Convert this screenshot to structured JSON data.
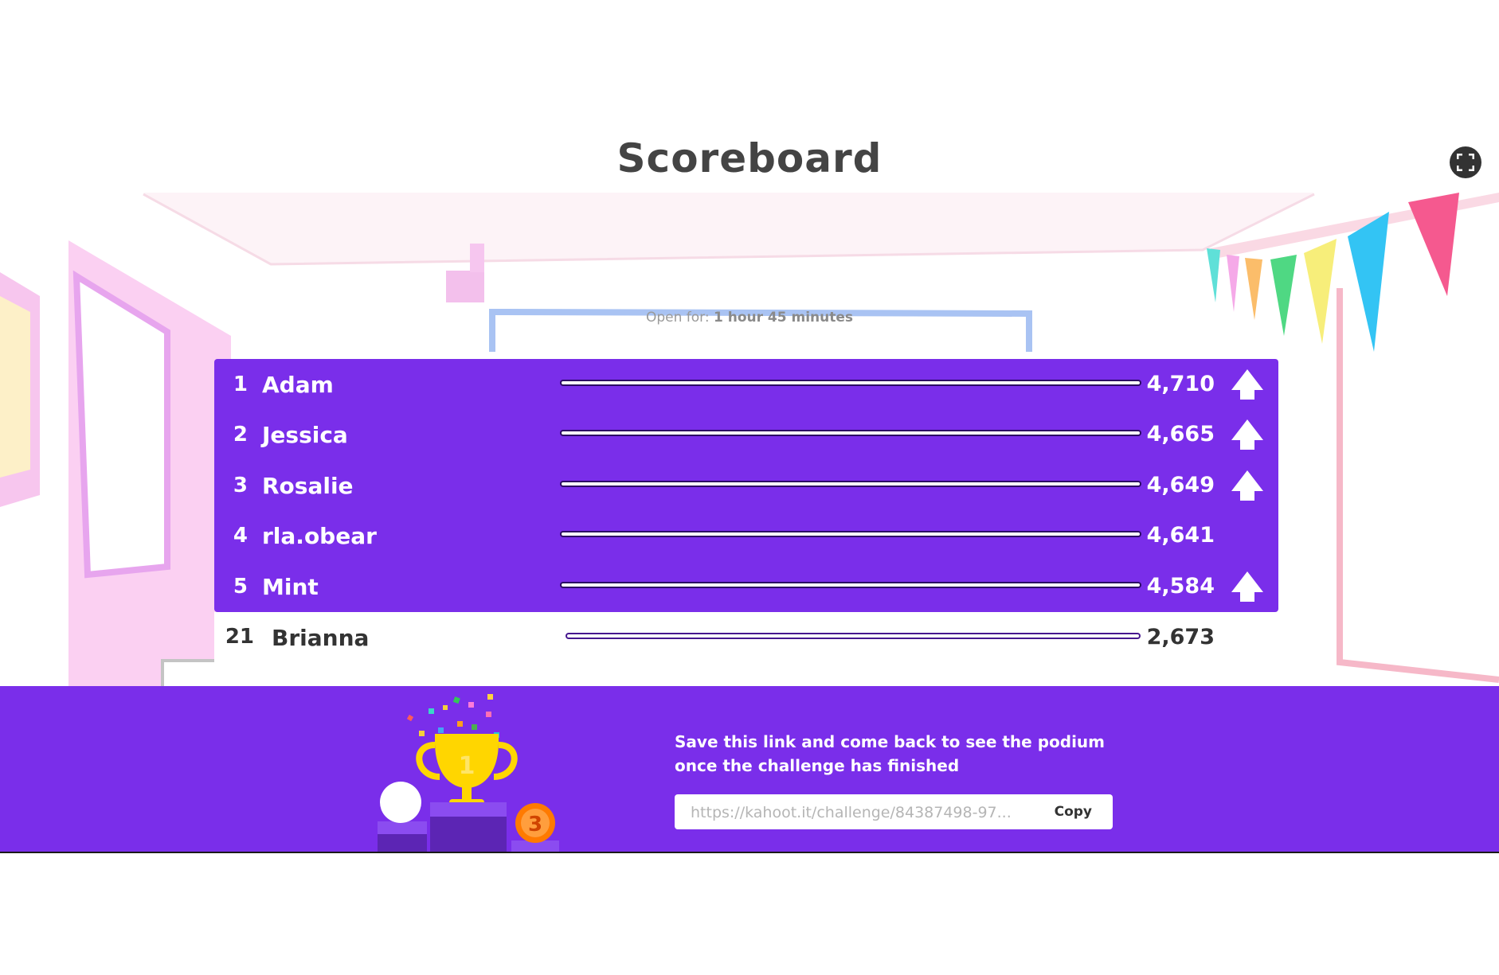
{
  "header": {
    "title": "Scoreboard",
    "fullscreen_icon": "fullscreen-icon"
  },
  "challenge": {
    "open_for_label": "Open for:",
    "open_for_value": "1 hour 45 minutes"
  },
  "leaderboard": {
    "players": [
      {
        "rank": "1",
        "name": "Adam",
        "score": "4,710",
        "trend": "up"
      },
      {
        "rank": "2",
        "name": "Jessica",
        "score": "4,665",
        "trend": "up"
      },
      {
        "rank": "3",
        "name": "Rosalie",
        "score": "4,649",
        "trend": "up"
      },
      {
        "rank": "4",
        "name": "rla.obear",
        "score": "4,641",
        "trend": "none"
      },
      {
        "rank": "5",
        "name": "Mint",
        "score": "4,584",
        "trend": "up"
      }
    ],
    "current_player": {
      "rank": "21",
      "name": "Brianna",
      "score": "2,673"
    }
  },
  "footer": {
    "message_line1": "Save this link and come back to see the podium",
    "message_line2": "once the challenge has finished",
    "link_value": "https://kahoot.it/challenge/84387498-97...",
    "copy_label": "Copy",
    "podium_badge": "3",
    "trophy_label": "1"
  },
  "colors": {
    "brand_purple": "#7a2eea",
    "dark_text": "#333333"
  }
}
